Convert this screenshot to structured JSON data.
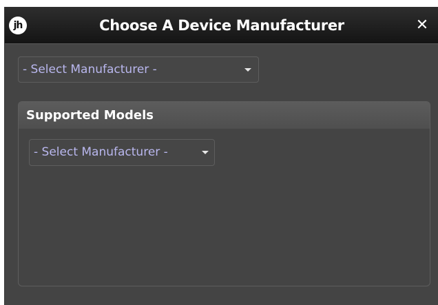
{
  "dialog": {
    "logo_text": "jh",
    "title": "Choose A Device Manufacturer",
    "close_glyph": "✕"
  },
  "manufacturer_select": {
    "selected": "- Select Manufacturer -"
  },
  "supported_models": {
    "header": "Supported Models",
    "select": {
      "selected": "- Select Manufacturer -"
    }
  },
  "icons": {
    "logo": "jh-logo-icon",
    "close": "close-icon",
    "dropdown": "chevron-down-icon"
  },
  "colors": {
    "dialog_bg": "#444444",
    "titlebar_bg": "#1c1c1c",
    "select_text": "#b9b7ee",
    "header_text": "#ffffff"
  }
}
